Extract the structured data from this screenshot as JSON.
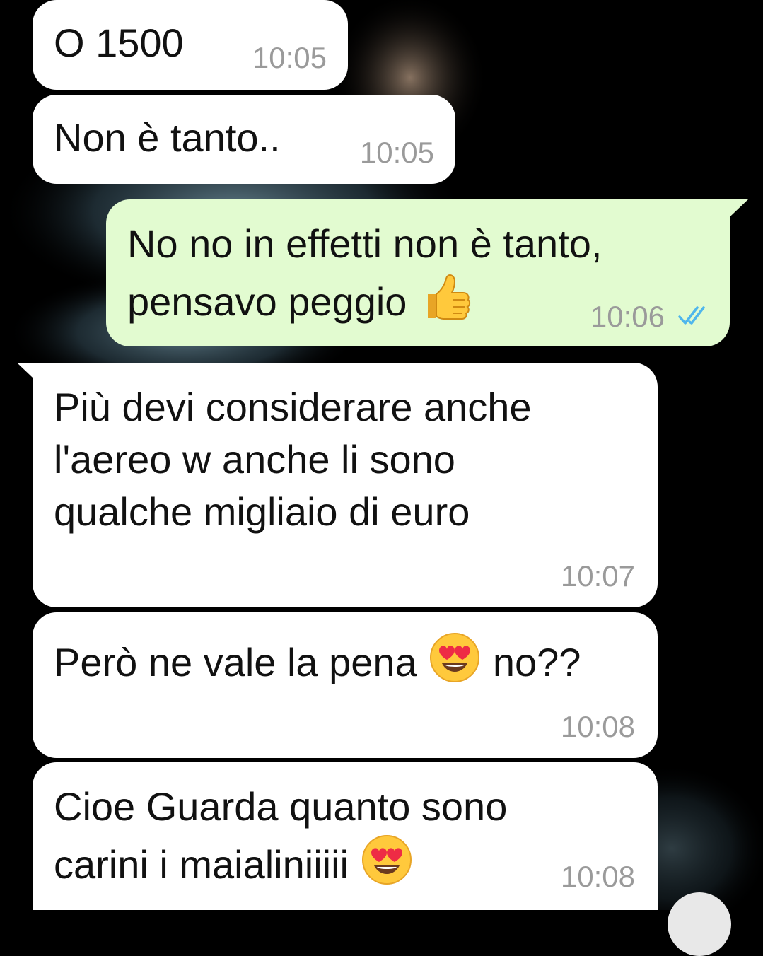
{
  "chat": {
    "messages": [
      {
        "direction": "incoming",
        "text": "O 1500",
        "time": "10:05"
      },
      {
        "direction": "incoming",
        "text": "Non è tanto..",
        "time": "10:05"
      },
      {
        "direction": "outgoing",
        "line1": "No no in effetti non è tanto,",
        "line2": "pensavo peggio",
        "emoji": "thumbs-up",
        "time": "10:06",
        "status": "read"
      },
      {
        "direction": "incoming",
        "text": "Più devi considerare anche\nl'aereo w anche li sono\nqualche migliaio di euro",
        "time": "10:07"
      },
      {
        "direction": "incoming",
        "before": "Però ne vale la pena",
        "emoji": "heart-eyes",
        "after": "no??",
        "time": "10:08"
      },
      {
        "direction": "incoming",
        "line1": "Cioe Guarda quanto sono",
        "line2": "carini i maialiniiiii",
        "emoji": "heart-eyes",
        "time": "10:08"
      }
    ]
  },
  "colors": {
    "background": "#000000",
    "incoming_bubble": "#ffffff",
    "outgoing_bubble": "#e2fbd0",
    "timestamp": "#9a9a9a",
    "read_ticks": "#4fb6ec"
  }
}
